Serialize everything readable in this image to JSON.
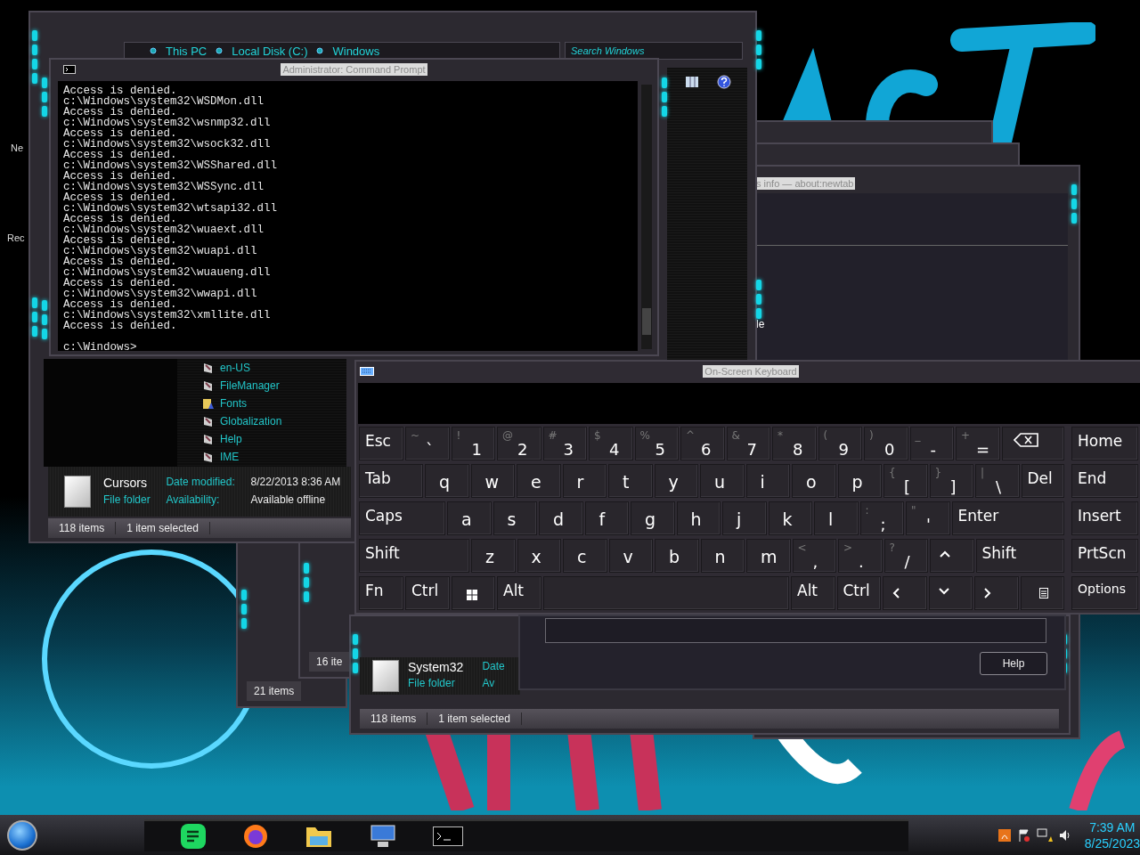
{
  "desktop": {
    "icons": [
      {
        "label": "Ne"
      },
      {
        "label": "Rec"
      }
    ]
  },
  "explorer": {
    "breadcrumbs": [
      "This PC",
      "Local Disk (C:)",
      "Windows"
    ],
    "search": {
      "placeholder": "Search Windows"
    },
    "files": [
      {
        "name": "en-US",
        "kind": "folder"
      },
      {
        "name": "FileManager",
        "kind": "folder"
      },
      {
        "name": "Fonts",
        "kind": "fonts"
      },
      {
        "name": "Globalization",
        "kind": "folder"
      },
      {
        "name": "Help",
        "kind": "folder"
      },
      {
        "name": "IME",
        "kind": "folder"
      }
    ],
    "details": {
      "name": "Cursors",
      "date_label": "Date modified:",
      "date": "8/22/2013 8:36 AM",
      "type": "File folder",
      "availability_label": "Availability:",
      "availability": "Available offline"
    },
    "status": {
      "count": "118 items",
      "selection": "1 item selected"
    }
  },
  "command_prompt": {
    "title": "Administrator: Command Prompt",
    "lines": [
      "Access is denied.",
      "c:\\Windows\\system32\\WSDMon.dll",
      "Access is denied.",
      "c:\\Windows\\system32\\wsnmp32.dll",
      "Access is denied.",
      "c:\\Windows\\system32\\wsock32.dll",
      "Access is denied.",
      "c:\\Windows\\system32\\WSShared.dll",
      "Access is denied.",
      "c:\\Windows\\system32\\WSSync.dll",
      "Access is denied.",
      "c:\\Windows\\system32\\wtsapi32.dll",
      "Access is denied.",
      "c:\\Windows\\system32\\wuaext.dll",
      "Access is denied.",
      "c:\\Windows\\system32\\wuapi.dll",
      "Access is denied.",
      "c:\\Windows\\system32\\wuaueng.dll",
      "Access is denied.",
      "c:\\Windows\\system32\\wwapi.dll",
      "Access is denied.",
      "c:\\Windows\\system32\\xmllite.dll",
      "Access is denied."
    ],
    "prompt": "c:\\Windows>"
  },
  "browser_window": {
    "title": "s info — about:newtab",
    "text": "le"
  },
  "small_windows": [
    {
      "status": "21 items"
    },
    {
      "status": "16 ite"
    }
  ],
  "system32_explorer": {
    "details": {
      "name": "System32",
      "date_label": "Date",
      "type": "File folder",
      "availability_label": "Av"
    },
    "status": {
      "count": "118 items",
      "selection": "1 item selected"
    }
  },
  "dialog": {
    "button": "Help"
  },
  "keyboard": {
    "title": "On-Screen Keyboard",
    "rows": [
      [
        {
          "kind": "text",
          "label": "Esc"
        },
        {
          "kind": "dual",
          "shift": "~",
          "label": "`"
        },
        {
          "kind": "dual",
          "shift": "!",
          "label": "1"
        },
        {
          "kind": "dual",
          "shift": "@",
          "label": "2"
        },
        {
          "kind": "dual",
          "shift": "#",
          "label": "3"
        },
        {
          "kind": "dual",
          "shift": "$",
          "label": "4"
        },
        {
          "kind": "dual",
          "shift": "%",
          "label": "5"
        },
        {
          "kind": "dual",
          "shift": "^",
          "label": "6"
        },
        {
          "kind": "dual",
          "shift": "&",
          "label": "7"
        },
        {
          "kind": "dual",
          "shift": "*",
          "label": "8"
        },
        {
          "kind": "dual",
          "shift": "(",
          "label": "9"
        },
        {
          "kind": "dual",
          "shift": ")",
          "label": "0"
        },
        {
          "kind": "dual",
          "shift": "_",
          "label": "-"
        },
        {
          "kind": "dual",
          "shift": "+",
          "label": "="
        },
        {
          "kind": "backspace"
        }
      ],
      [
        {
          "kind": "text",
          "label": "Tab"
        },
        {
          "kind": "char",
          "label": "q"
        },
        {
          "kind": "char",
          "label": "w"
        },
        {
          "kind": "char",
          "label": "e"
        },
        {
          "kind": "char",
          "label": "r"
        },
        {
          "kind": "char",
          "label": "t"
        },
        {
          "kind": "char",
          "label": "y"
        },
        {
          "kind": "char",
          "label": "u"
        },
        {
          "kind": "char",
          "label": "i"
        },
        {
          "kind": "char",
          "label": "o"
        },
        {
          "kind": "char",
          "label": "p"
        },
        {
          "kind": "dual",
          "shift": "{",
          "label": "["
        },
        {
          "kind": "dual",
          "shift": "}",
          "label": "]"
        },
        {
          "kind": "dual",
          "shift": "|",
          "label": "\\"
        },
        {
          "kind": "text",
          "label": "Del"
        }
      ],
      [
        {
          "kind": "text",
          "label": "Caps"
        },
        {
          "kind": "char",
          "label": "a"
        },
        {
          "kind": "char",
          "label": "s"
        },
        {
          "kind": "char",
          "label": "d"
        },
        {
          "kind": "char",
          "label": "f"
        },
        {
          "kind": "char",
          "label": "g"
        },
        {
          "kind": "char",
          "label": "h"
        },
        {
          "kind": "char",
          "label": "j"
        },
        {
          "kind": "char",
          "label": "k"
        },
        {
          "kind": "char",
          "label": "l"
        },
        {
          "kind": "dual",
          "shift": ":",
          "label": ";"
        },
        {
          "kind": "dual",
          "shift": "\"",
          "label": "'"
        },
        {
          "kind": "text",
          "label": "Enter"
        }
      ],
      [
        {
          "kind": "text",
          "label": "Shift"
        },
        {
          "kind": "char",
          "label": "z"
        },
        {
          "kind": "char",
          "label": "x"
        },
        {
          "kind": "char",
          "label": "c"
        },
        {
          "kind": "char",
          "label": "v"
        },
        {
          "kind": "char",
          "label": "b"
        },
        {
          "kind": "char",
          "label": "n"
        },
        {
          "kind": "char",
          "label": "m"
        },
        {
          "kind": "dual",
          "shift": "<",
          "label": ","
        },
        {
          "kind": "dual",
          "shift": ">",
          "label": "."
        },
        {
          "kind": "dual",
          "shift": "?",
          "label": "/"
        },
        {
          "kind": "up"
        },
        {
          "kind": "text",
          "label": "Shift"
        }
      ],
      [
        {
          "kind": "text",
          "label": "Fn"
        },
        {
          "kind": "text",
          "label": "Ctrl"
        },
        {
          "kind": "windows"
        },
        {
          "kind": "text",
          "label": "Alt"
        },
        {
          "kind": "space"
        },
        {
          "kind": "text",
          "label": "Alt"
        },
        {
          "kind": "text",
          "label": "Ctrl"
        },
        {
          "kind": "left"
        },
        {
          "kind": "down"
        },
        {
          "kind": "right"
        },
        {
          "kind": "menu"
        }
      ]
    ],
    "nav_keys": [
      "Home",
      "End",
      "Insert",
      "PrtScn",
      "Options"
    ]
  },
  "taskbar": {
    "time": "7:39 AM",
    "date": "8/25/2023"
  }
}
